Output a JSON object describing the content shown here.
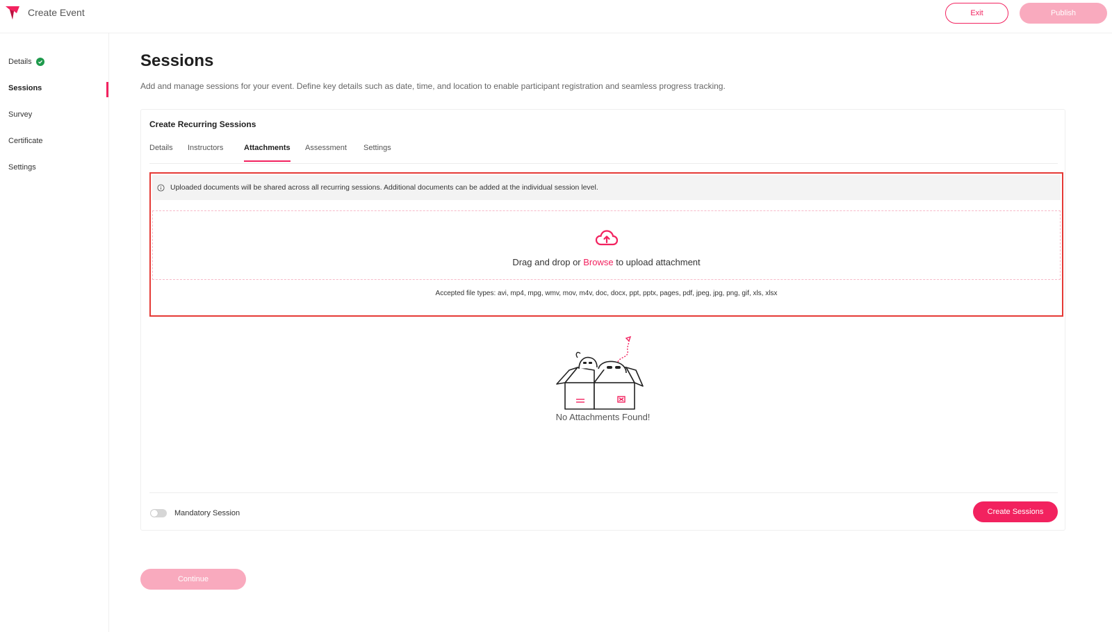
{
  "header": {
    "title": "Create Event",
    "exit_label": "Exit",
    "publish_label": "Publish",
    "logo_icon": "brand-logo-icon",
    "accent_color": "#f2225f"
  },
  "sidebar": {
    "items": [
      {
        "label": "Details",
        "status": "completed",
        "icon": "check-circle-icon"
      },
      {
        "label": "Sessions",
        "active": true
      },
      {
        "label": "Survey"
      },
      {
        "label": "Certificate"
      },
      {
        "label": "Settings"
      }
    ]
  },
  "main": {
    "title": "Sessions",
    "description": "Add and manage sessions for your event. Define key details such as date, time, and location to enable participant registration and seamless progress tracking."
  },
  "card": {
    "title": "Create Recurring Sessions",
    "tabs": [
      {
        "label": "Details"
      },
      {
        "label": "Instructors"
      },
      {
        "label": "Attachments",
        "active": true
      },
      {
        "label": "Assessment"
      },
      {
        "label": "Settings"
      }
    ],
    "info_banner": "Uploaded documents will be shared across all recurring sessions. Additional documents can be added at the individual session level.",
    "upload": {
      "prefix": "Drag and drop or ",
      "browse_label": "Browse",
      "suffix": " to upload attachment",
      "accepted_types": "Accepted file types: avi, mp4, mpg, wmv, mov, m4v, doc, docx, ppt, pptx, pages, pdf, jpeg, jpg, png, gif, xls, xlsx",
      "icon": "cloud-upload-icon"
    },
    "empty_state": "No Attachments Found!",
    "mandatory_label": "Mandatory Session",
    "mandatory_enabled": false,
    "create_label": "Create Sessions"
  },
  "continue_label": "Continue"
}
